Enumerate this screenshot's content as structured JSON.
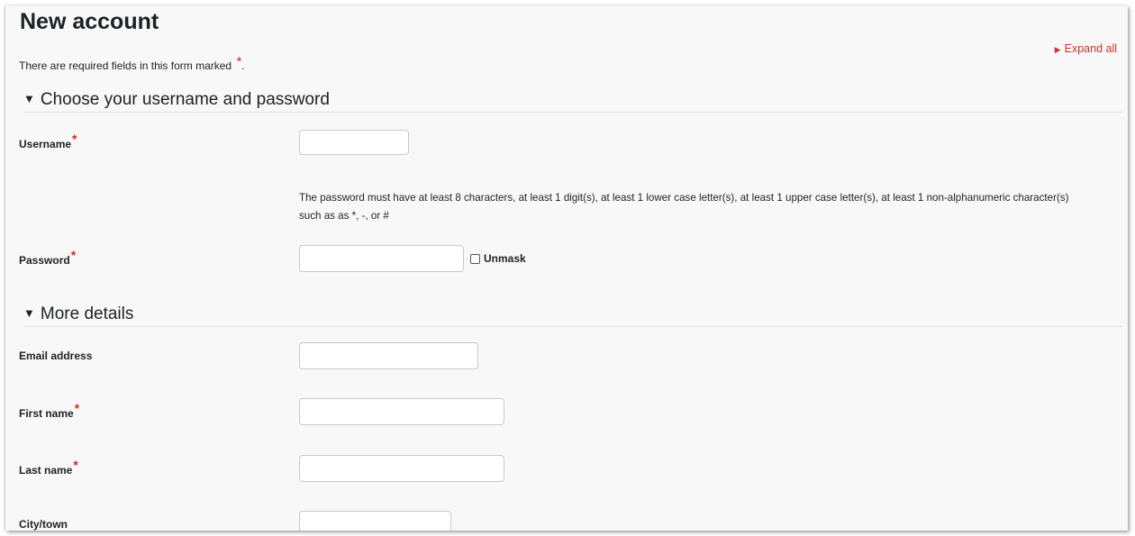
{
  "page_title": "New account",
  "required_note": "There are required fields in this form marked",
  "required_marker": "*",
  "required_note_end": ".",
  "expand_all": "Expand all",
  "sections": {
    "account": "Choose your username and password",
    "details": "More details"
  },
  "fields": {
    "username": {
      "label": "Username",
      "value": ""
    },
    "password_help": "The password must have at least 8 characters, at least 1 digit(s), at least 1 lower case letter(s), at least 1 upper case letter(s), at least 1 non-alphanumeric character(s) such as as *, -, or #",
    "password": {
      "label": "Password",
      "value": "",
      "unmask_label": "Unmask"
    },
    "email": {
      "label": "Email address",
      "value": ""
    },
    "first_name": {
      "label": "First name",
      "value": ""
    },
    "last_name": {
      "label": "Last name",
      "value": ""
    },
    "city": {
      "label": "City/town",
      "value": ""
    }
  },
  "colors": {
    "accent": "#d0312d",
    "required": "#ca3120",
    "background": "#f8f8f8"
  },
  "icons": {
    "expand": "triangle-right-icon",
    "section_collapse": "triangle-down-icon"
  }
}
